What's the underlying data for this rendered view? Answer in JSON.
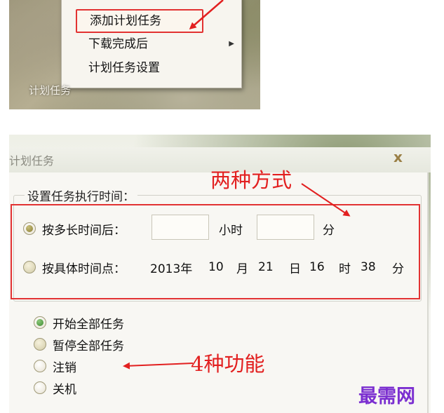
{
  "context_menu": {
    "items": [
      {
        "label": "添加计划任务",
        "highlighted": true
      },
      {
        "label": "下载完成后",
        "has_submenu": true
      },
      {
        "label": "计划任务设置"
      }
    ],
    "submenu_glyph": "▶"
  },
  "taskbar": {
    "label": "计划任务"
  },
  "dialog": {
    "title": "计划任务",
    "close_glyph": "x",
    "group_title": "设置任务执行时间：",
    "option_after": {
      "label": "按多长时间后：",
      "hour_value": "",
      "hour_unit": "小时",
      "minute_value": "",
      "minute_unit": "分",
      "checked": true
    },
    "option_at": {
      "label": "按具体时间点：",
      "year": "2013年",
      "month_value": "10",
      "month_unit": "月",
      "day_value": "21",
      "day_unit": "日",
      "hour_value": "16",
      "hour_unit": "时",
      "minute_value": "38",
      "minute_unit": "分",
      "checked": false
    },
    "functions": [
      {
        "label": "开始全部任务",
        "checked": true
      },
      {
        "label": "暂停全部任务",
        "checked": false
      },
      {
        "label": "注销",
        "checked": false
      },
      {
        "label": "关机",
        "checked": false
      }
    ]
  },
  "annotations": {
    "two_ways": "两种方式",
    "four_functions": "4种功能"
  },
  "watermark": "最需网",
  "colors": {
    "annotation_red": "#e22020",
    "watermark_purple": "#7b2fd0"
  }
}
